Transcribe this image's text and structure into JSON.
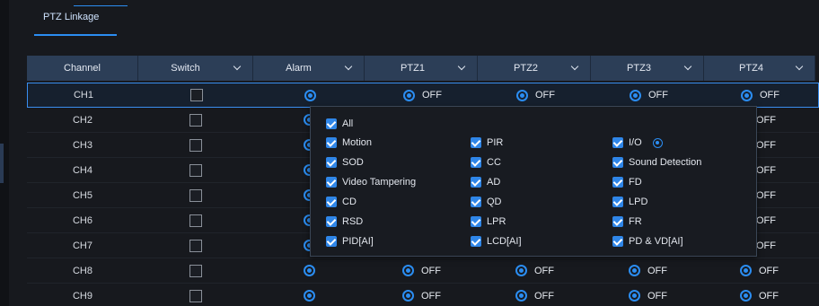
{
  "tab": {
    "label": "PTZ Linkage"
  },
  "header": {
    "channel": "Channel",
    "switch": "Switch",
    "alarm": "Alarm",
    "ptz1": "PTZ1",
    "ptz2": "PTZ2",
    "ptz3": "PTZ3",
    "ptz4": "PTZ4"
  },
  "rows": [
    {
      "ch": "CH1",
      "p1": "OFF",
      "p2": "OFF",
      "p3": "OFF",
      "p4": "OFF"
    },
    {
      "ch": "CH2",
      "p4": "OFF"
    },
    {
      "ch": "CH3",
      "p4": "OFF"
    },
    {
      "ch": "CH4",
      "p4": "OFF"
    },
    {
      "ch": "CH5",
      "p4": "OFF"
    },
    {
      "ch": "CH6",
      "p4": "OFF"
    },
    {
      "ch": "CH7",
      "p4": "OFF"
    },
    {
      "ch": "CH8",
      "p1": "OFF",
      "p2": "OFF",
      "p3": "OFF",
      "p4": "OFF"
    },
    {
      "ch": "CH9",
      "p1": "OFF",
      "p2": "OFF",
      "p3": "OFF",
      "p4": "OFF"
    }
  ],
  "alarm_menu": {
    "all": "All",
    "motion": "Motion",
    "pir": "PIR",
    "io": "I/O",
    "sod": "SOD",
    "cc": "CC",
    "sound": "Sound Detection",
    "tamper": "Video Tampering",
    "ad": "AD",
    "fd": "FD",
    "cd": "CD",
    "qd": "QD",
    "lpd": "LPD",
    "rsd": "RSD",
    "lpr": "LPR",
    "fr": "FR",
    "pid": "PID[AI]",
    "lcd": "LCD[AI]",
    "pdvd": "PD & VD[AI]"
  },
  "colors": {
    "accent": "#2b8df2",
    "header_bg": "#2c3e57",
    "bg": "#17191e"
  }
}
